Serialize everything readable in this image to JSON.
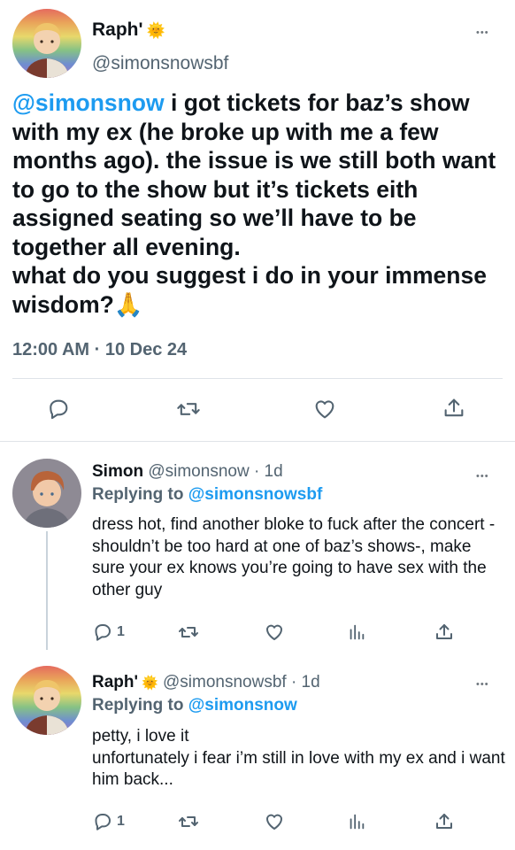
{
  "main_tweet": {
    "name": "Raph'",
    "badge": "🌞",
    "handle": "@simonsnowsbf",
    "mention": "@simonsnow",
    "text": " i got tickets for baz’s show with my ex (he broke up with me a few months ago). the issue is we still both want to go to the show but it’s tickets eith assigned seating so we’ll have to be together all evening.\nwhat do you suggest i do in your immense wisdom?🙏",
    "time": "12:00 AM · 10 Dec 24",
    "more_label": "•••"
  },
  "replies": [
    {
      "name": "Simon",
      "handle": "@simonsnow",
      "age": " · 1d",
      "replying_prefix": "Replying to ",
      "replying_to": "@simonsnowsbf",
      "text": "dress hot, find another bloke to fuck after the concert -shouldn’t be too hard at one of baz’s shows-, make sure your ex knows you’re going to have sex with the other guy",
      "reply_count": "1",
      "more_label": "•••"
    },
    {
      "name": "Raph'",
      "badge": "🌞",
      "handle": "@simonsnowsbf",
      "age": " · 1d",
      "replying_prefix": "Replying to ",
      "replying_to": "@simonsnow",
      "text": "petty, i love it\nunfortunately i fear i’m still in love with my ex and i want him back...",
      "reply_count": "1",
      "more_label": "•••"
    }
  ],
  "icons": {
    "reply": "reply-icon",
    "retweet": "retweet-icon",
    "like": "heart-icon",
    "stats": "stats-icon",
    "share": "share-icon"
  },
  "colors": {
    "accent": "#1d9bf0",
    "muted": "#536471",
    "divider": "#dfe3e8"
  }
}
